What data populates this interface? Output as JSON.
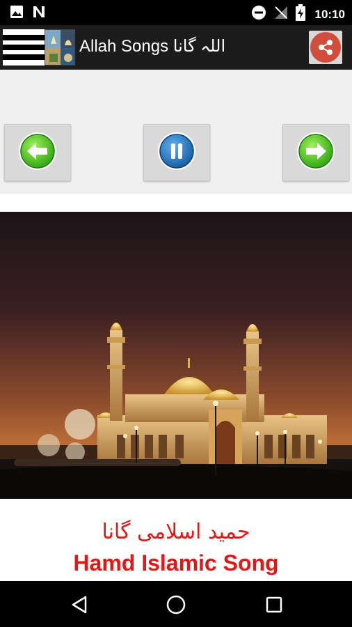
{
  "status_bar": {
    "time": "10:10",
    "icons": [
      "image-icon",
      "n-notification-icon",
      "do-not-disturb-icon",
      "no-signal-icon",
      "battery-charging-icon"
    ]
  },
  "app_bar": {
    "title": "Allah Songs اللہ گانا",
    "menu_icon": "menu-icon",
    "share_icon": "share-icon"
  },
  "controls": {
    "prev_icon": "arrow-left-icon",
    "pause_icon": "pause-icon",
    "next_icon": "arrow-right-icon"
  },
  "song": {
    "title_urdu": "حمید اسلامی گانا",
    "title_english": "Hamd Islamic Song"
  },
  "colors": {
    "title_red": "#e01818",
    "share_red": "#d14d3c",
    "green": "#3fbf1e",
    "blue": "#1e6fc0"
  },
  "nav_bar": {
    "back_icon": "back-icon",
    "home_icon": "home-icon",
    "recents_icon": "recents-icon"
  }
}
